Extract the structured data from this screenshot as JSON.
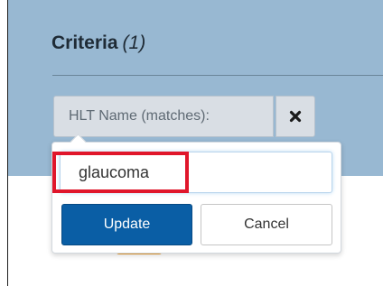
{
  "criteria": {
    "title": "Criteria",
    "count": "(1)"
  },
  "filter": {
    "label": "HLT Name (matches):",
    "remove_icon": "close-icon"
  },
  "editor": {
    "value": "glaucoma",
    "update_label": "Update",
    "cancel_label": "Cancel"
  },
  "colors": {
    "panel": "#98b8d2",
    "primary_button": "#0a5ea5",
    "highlight": "#e0162b",
    "accent_tab": "#f0a030"
  }
}
